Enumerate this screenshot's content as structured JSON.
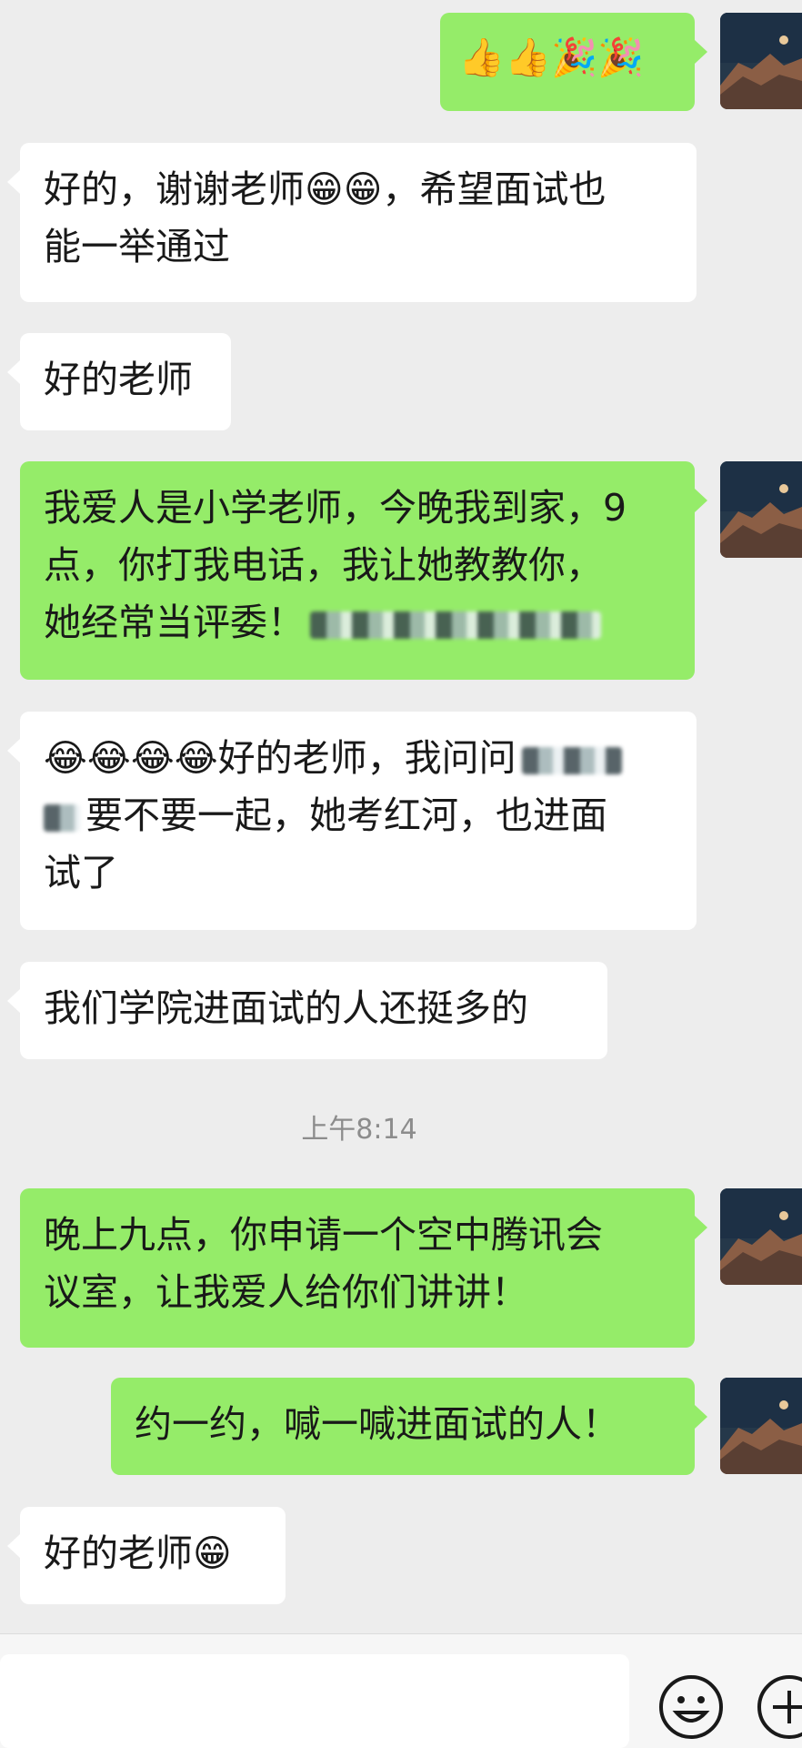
{
  "time_divider": "上午8:14",
  "messages": [
    {
      "side": "out",
      "text": "",
      "emojis": "👍👍🎉🎉"
    },
    {
      "side": "in",
      "text_a": "好的，谢谢老师",
      "emojis": "😁😁",
      "text_b": "，希望面试也",
      "text_c": "能一举通过"
    },
    {
      "side": "in",
      "text": "好的老师"
    },
    {
      "side": "out",
      "line1": "我爱人是小学老师，今晚我到家，9",
      "line2": "点，你打我电话，我让她教教你，",
      "line3": "她经常当评委！"
    },
    {
      "side": "in",
      "emojis": "😂😂😂😂",
      "line1": "好的老师，我问问",
      "line2": "要不要一起，她考红河，也进面",
      "line3": "试了"
    },
    {
      "side": "in",
      "text": "我们学院进面试的人还挺多的"
    },
    {
      "side": "out",
      "line1": "晚上九点，你申请一个空中腾讯会",
      "line2": "议室，让我爱人给你们讲讲！"
    },
    {
      "side": "out",
      "text": "约一约，喊一喊进面试的人！"
    },
    {
      "side": "in",
      "text": "好的老师",
      "emojis": "😁"
    }
  ],
  "input_bar": {
    "emoji_icon": "smiley-icon",
    "plus_icon": "plus-icon"
  },
  "colors": {
    "background": "#ededed",
    "outgoing": "#95ec69",
    "incoming": "#ffffff",
    "time": "#8c8c8c"
  }
}
